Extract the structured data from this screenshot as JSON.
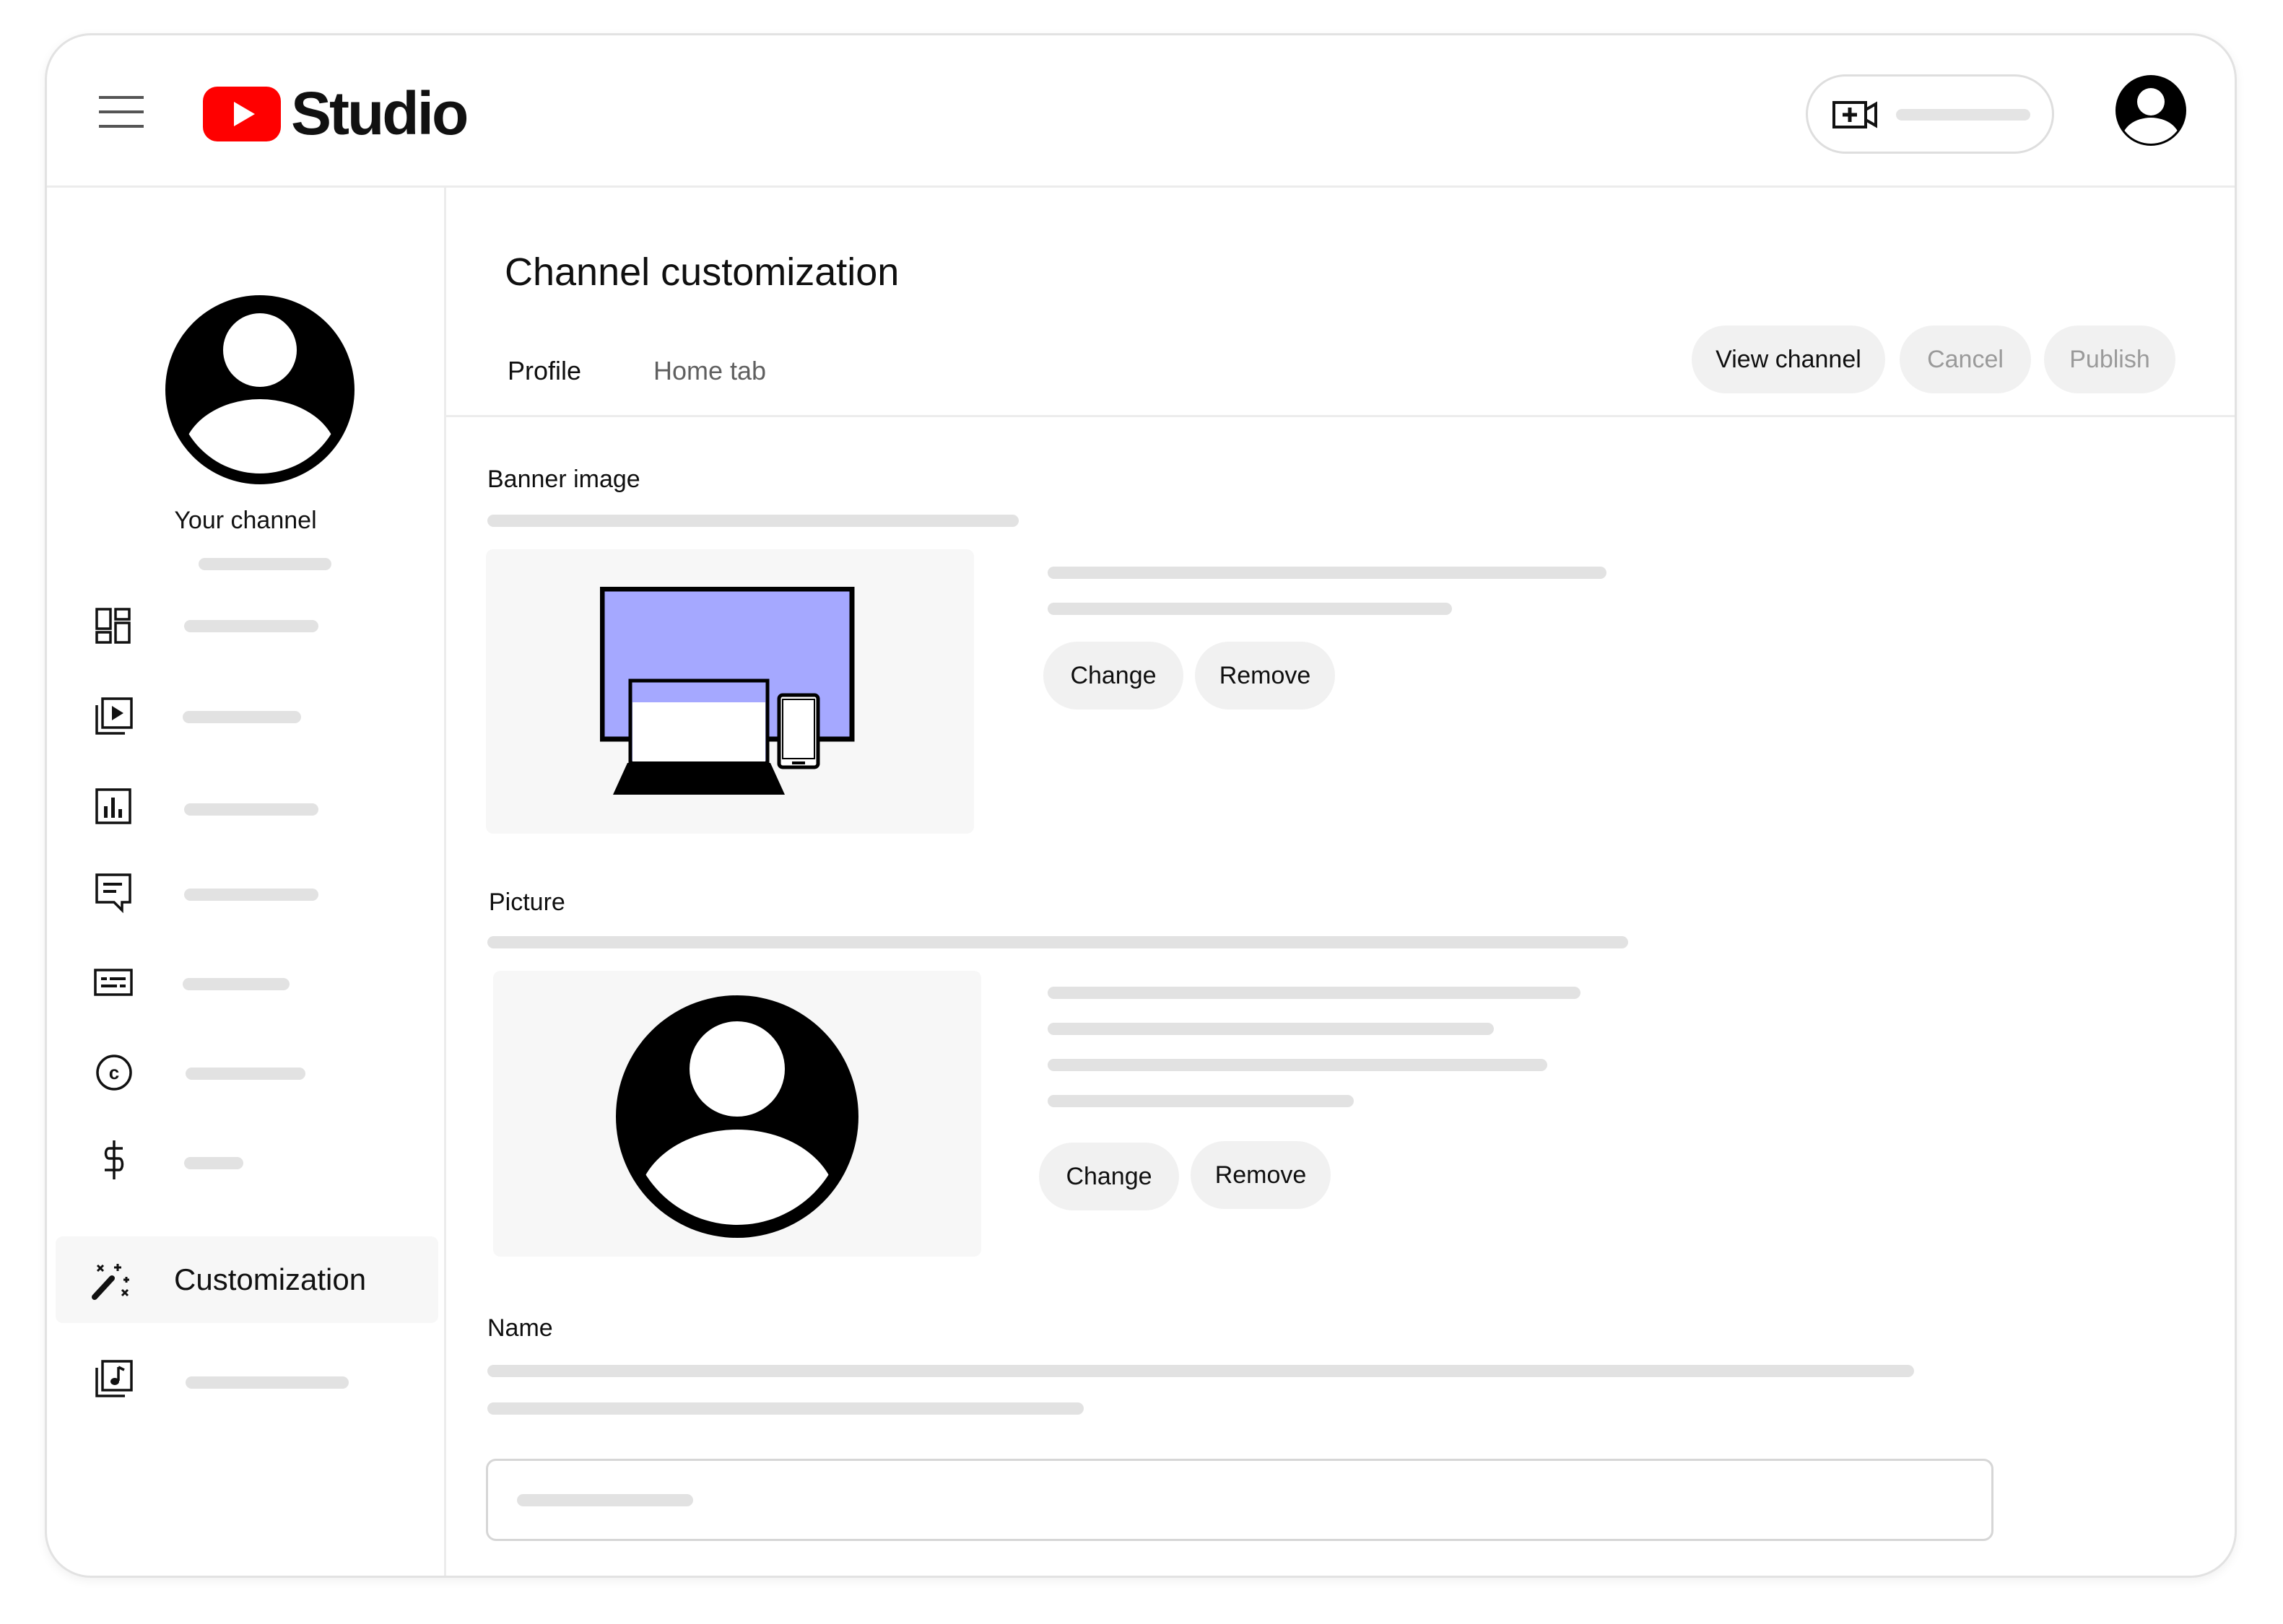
{
  "app": {
    "title": "Studio"
  },
  "sidebar": {
    "channel_label": "Your channel",
    "items": [
      {
        "icon": "dashboard-icon",
        "label": ""
      },
      {
        "icon": "content-icon",
        "label": ""
      },
      {
        "icon": "analytics-icon",
        "label": ""
      },
      {
        "icon": "comments-icon",
        "label": ""
      },
      {
        "icon": "subtitles-icon",
        "label": ""
      },
      {
        "icon": "copyright-icon",
        "label": ""
      },
      {
        "icon": "earn-icon",
        "label": ""
      },
      {
        "icon": "customization-icon",
        "label": "Customization",
        "active": true
      },
      {
        "icon": "audio-library-icon",
        "label": ""
      }
    ]
  },
  "main": {
    "title": "Channel customization",
    "tabs": [
      {
        "label": "Profile",
        "active": true
      },
      {
        "label": "Home tab",
        "active": false
      }
    ],
    "actions": {
      "view_channel": "View channel",
      "cancel": "Cancel",
      "publish": "Publish"
    },
    "banner": {
      "label": "Banner image",
      "change": "Change",
      "remove": "Remove"
    },
    "picture": {
      "label": "Picture",
      "change": "Change",
      "remove": "Remove"
    },
    "name": {
      "label": "Name"
    }
  },
  "colors": {
    "brand_red": "#ff0000",
    "banner_purple": "#a5a8ff",
    "skeleton": "#e2e2e2",
    "button_bg": "#f1f1f1"
  }
}
